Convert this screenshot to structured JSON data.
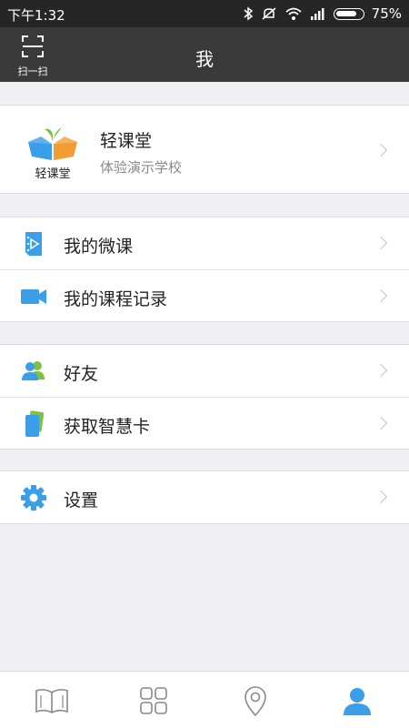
{
  "status_bar": {
    "time": "下午1:32",
    "battery": "75%"
  },
  "header": {
    "title": "我",
    "scan_label": "扫一扫"
  },
  "profile": {
    "name": "轻课堂",
    "school": "体验演示学校",
    "logo_text": "轻课堂"
  },
  "groups": [
    {
      "items": [
        {
          "label": "我的微课",
          "icon": "micro-lesson-icon"
        },
        {
          "label": "我的课程记录",
          "icon": "video-camera-icon"
        }
      ]
    },
    {
      "items": [
        {
          "label": "好友",
          "icon": "friends-icon"
        },
        {
          "label": "获取智慧卡",
          "icon": "smart-card-icon"
        }
      ]
    },
    {
      "items": [
        {
          "label": "设置",
          "icon": "gear-icon"
        }
      ]
    }
  ],
  "tab_bar": {
    "tabs": [
      "book-icon",
      "grid-icon",
      "location-icon",
      "user-icon"
    ],
    "active": "user-icon"
  },
  "colors": {
    "accent": "#3a9ee8",
    "header_bg": "#3a3a3a",
    "status_bg": "#262626",
    "page_bg": "#efeff4"
  }
}
